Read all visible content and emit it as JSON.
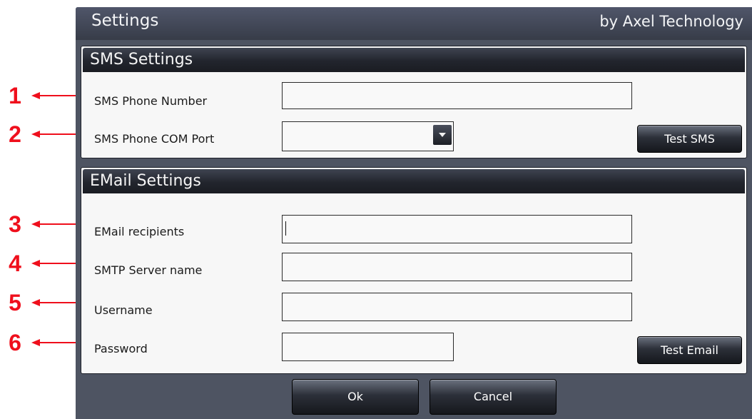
{
  "window": {
    "title": "Settings",
    "vendor": "by Axel Technology"
  },
  "annotations": [
    "1",
    "2",
    "3",
    "4",
    "5",
    "6"
  ],
  "sms": {
    "header": "SMS Settings",
    "phone_number_label": "SMS Phone Number",
    "phone_number_value": "",
    "com_port_label": "SMS Phone COM Port",
    "com_port_value": "",
    "test_button": "Test SMS"
  },
  "email": {
    "header": "EMail Settings",
    "recipients_label": "EMail recipients",
    "recipients_value": "",
    "smtp_label": "SMTP Server name",
    "smtp_value": "",
    "username_label": "Username",
    "username_value": "",
    "password_label": "Password",
    "password_value": "",
    "test_button": "Test Email"
  },
  "footer": {
    "ok_button": "Ok",
    "cancel_button": "Cancel"
  },
  "colors": {
    "annotation_red": "#ef0f1c",
    "window_bg": "#4e5462",
    "panel_bg": "#f7f7f7"
  }
}
